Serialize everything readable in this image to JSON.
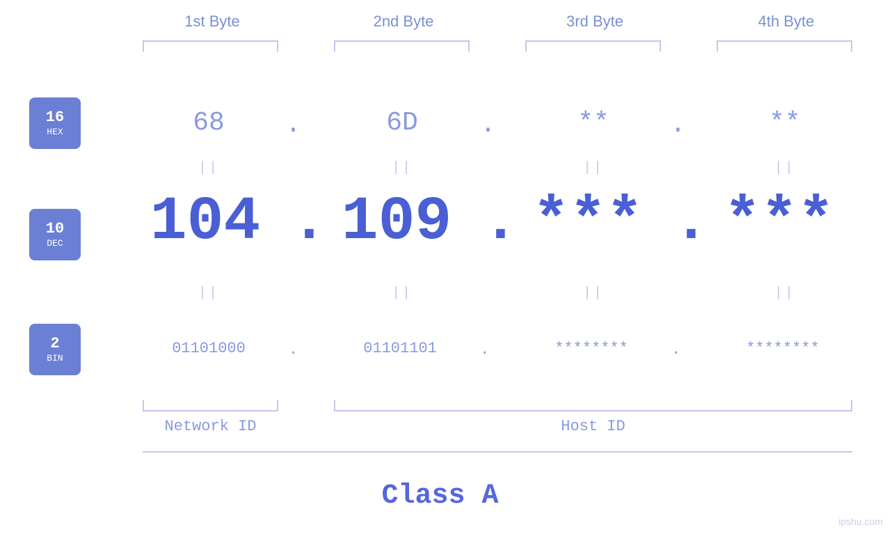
{
  "byteHeaders": {
    "b1": "1st Byte",
    "b2": "2nd Byte",
    "b3": "3rd Byte",
    "b4": "4th Byte"
  },
  "badges": {
    "hex": {
      "num": "16",
      "label": "HEX"
    },
    "dec": {
      "num": "10",
      "label": "DEC"
    },
    "bin": {
      "num": "2",
      "label": "BIN"
    }
  },
  "hex": {
    "b1": "68",
    "b2": "6D",
    "b3": "**",
    "b4": "**"
  },
  "dec": {
    "b1": "104",
    "b2": "109",
    "b3": "***",
    "b4": "***"
  },
  "bin": {
    "b1": "01101000",
    "b2": "01101101",
    "b3": "********",
    "b4": "********"
  },
  "equals": "||",
  "dot": ".",
  "labels": {
    "networkId": "Network ID",
    "hostId": "Host ID",
    "classA": "Class A"
  },
  "watermark": "ipshu.com"
}
